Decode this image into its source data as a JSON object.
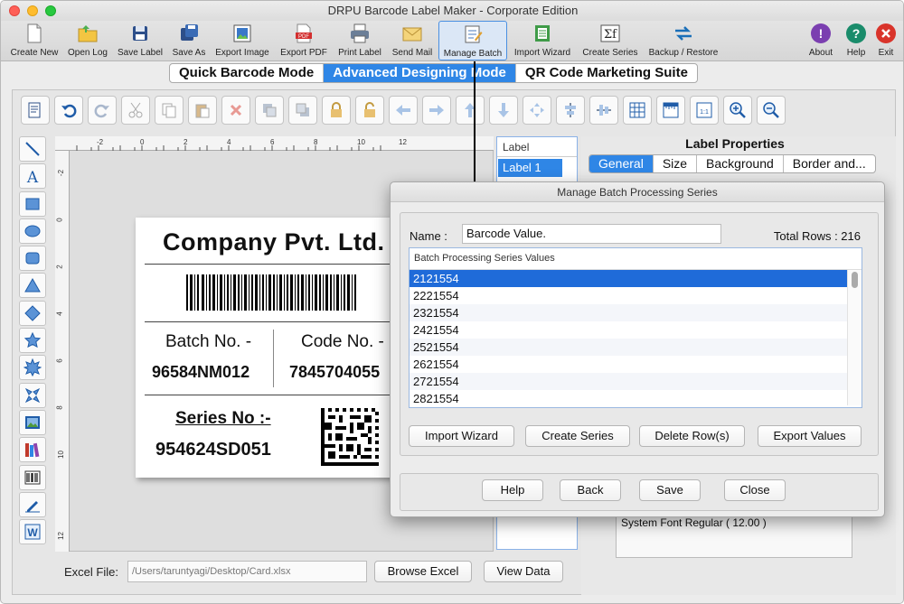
{
  "window": {
    "title": "DRPU Barcode Label Maker - Corporate Edition"
  },
  "toolbar": {
    "items": [
      {
        "label": "Create New",
        "icon": "create-new-icon"
      },
      {
        "label": "Open Log",
        "icon": "open-folder-icon"
      },
      {
        "label": "Save Label",
        "icon": "floppy-disk-icon"
      },
      {
        "label": "Save As",
        "icon": "save-as-icon"
      },
      {
        "label": "Export Image",
        "icon": "export-image-icon"
      },
      {
        "label": "Export PDF",
        "icon": "pdf-icon"
      },
      {
        "label": "Print Label",
        "icon": "printer-icon"
      },
      {
        "label": "Send Mail",
        "icon": "mail-icon"
      },
      {
        "label": "Manage Batch",
        "icon": "manage-batch-icon"
      },
      {
        "label": "Import Wizard",
        "icon": "import-wizard-icon"
      },
      {
        "label": "Create Series",
        "icon": "sigma-icon"
      },
      {
        "label": "Backup / Restore",
        "icon": "backup-restore-icon"
      },
      {
        "label": "About",
        "icon": "question-circle-icon"
      },
      {
        "label": "Help",
        "icon": "help-circle-icon"
      },
      {
        "label": "Exit",
        "icon": "exit-icon"
      }
    ]
  },
  "modes": {
    "quick": "Quick Barcode Mode",
    "advanced": "Advanced Designing Mode",
    "qr": "QR Code Marketing Suite"
  },
  "label": {
    "company": "Company Pvt. Ltd.",
    "batch_label": "Batch No. -",
    "batch_value": "96584NM012",
    "code_label": "Code No. -",
    "code_value": "7845704055",
    "series_label": "Series No :-",
    "series_value": "954624SD051"
  },
  "ruler": {
    "h": [
      "-2",
      "0",
      "2",
      "4",
      "6",
      "8",
      "10",
      "12"
    ],
    "v": [
      "-2",
      "0",
      "2",
      "4",
      "6",
      "8",
      "10",
      "12"
    ]
  },
  "labels_panel": {
    "header": "Label",
    "items": [
      "Label 1"
    ]
  },
  "properties": {
    "title": "Label Properties",
    "tabs": [
      "General",
      "Size",
      "Background",
      "Border and..."
    ],
    "font_value": "System Font Regular ( 12.00 )"
  },
  "bottom": {
    "excel_label": "Excel File:",
    "excel_path": "/Users/taruntyagi/Desktop/Card.xlsx",
    "browse": "Browse Excel",
    "view": "View Data"
  },
  "dialog": {
    "title": "Manage Batch Processing Series",
    "name_label": "Name :",
    "name_value": "Barcode Value.",
    "total_rows": "Total Rows : 216",
    "table_header": "Batch Processing Series Values",
    "rows": [
      "2121554",
      "2221554",
      "2321554",
      "2421554",
      "2521554",
      "2621554",
      "2721554",
      "2821554"
    ],
    "selected_row": 0,
    "buttons": [
      "Import Wizard",
      "Create Series",
      "Delete Row(s)",
      "Export Values"
    ],
    "footer": [
      "Help",
      "Back",
      "Save",
      "Close"
    ]
  },
  "colors": {
    "accent": "#2f86e6",
    "selection": "#1f6bd9",
    "close": "#fe5f57",
    "minimize": "#febc2e",
    "maximize": "#28c840"
  }
}
